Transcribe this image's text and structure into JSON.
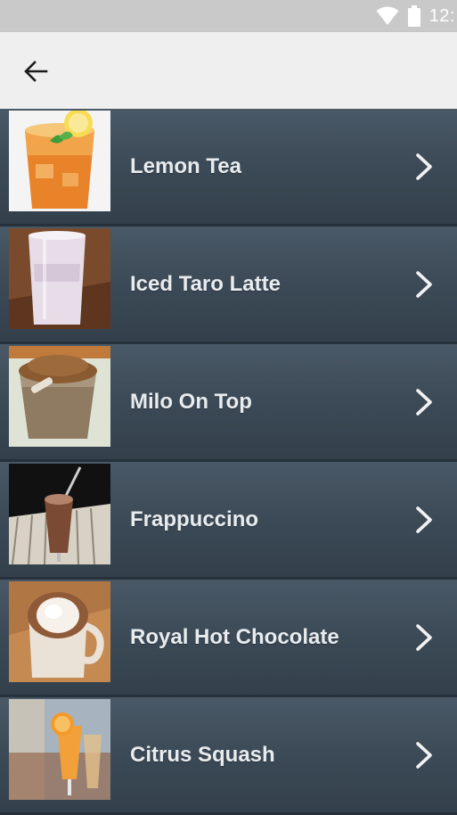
{
  "status_bar": {
    "time": "12:",
    "icons": [
      "wifi-icon",
      "battery-icon"
    ]
  },
  "app_bar": {
    "back_icon": "arrow-left-icon"
  },
  "colors": {
    "row_bg": "#3c4a57",
    "row_divider": "#26313b",
    "label": "#e8ecef",
    "appbar_bg": "#efefef",
    "statusbar_bg": "#c9c9c9"
  },
  "menu": {
    "items": [
      {
        "label": "Lemon Tea",
        "icon": "chevron-right-icon"
      },
      {
        "label": "Iced Taro Latte",
        "icon": "chevron-right-icon"
      },
      {
        "label": "Milo On Top",
        "icon": "chevron-right-icon"
      },
      {
        "label": "Frappuccino",
        "icon": "chevron-right-icon"
      },
      {
        "label": "Royal Hot Chocolate",
        "icon": "chevron-right-icon"
      },
      {
        "label": "Citrus Squash",
        "icon": "chevron-right-icon"
      }
    ]
  }
}
